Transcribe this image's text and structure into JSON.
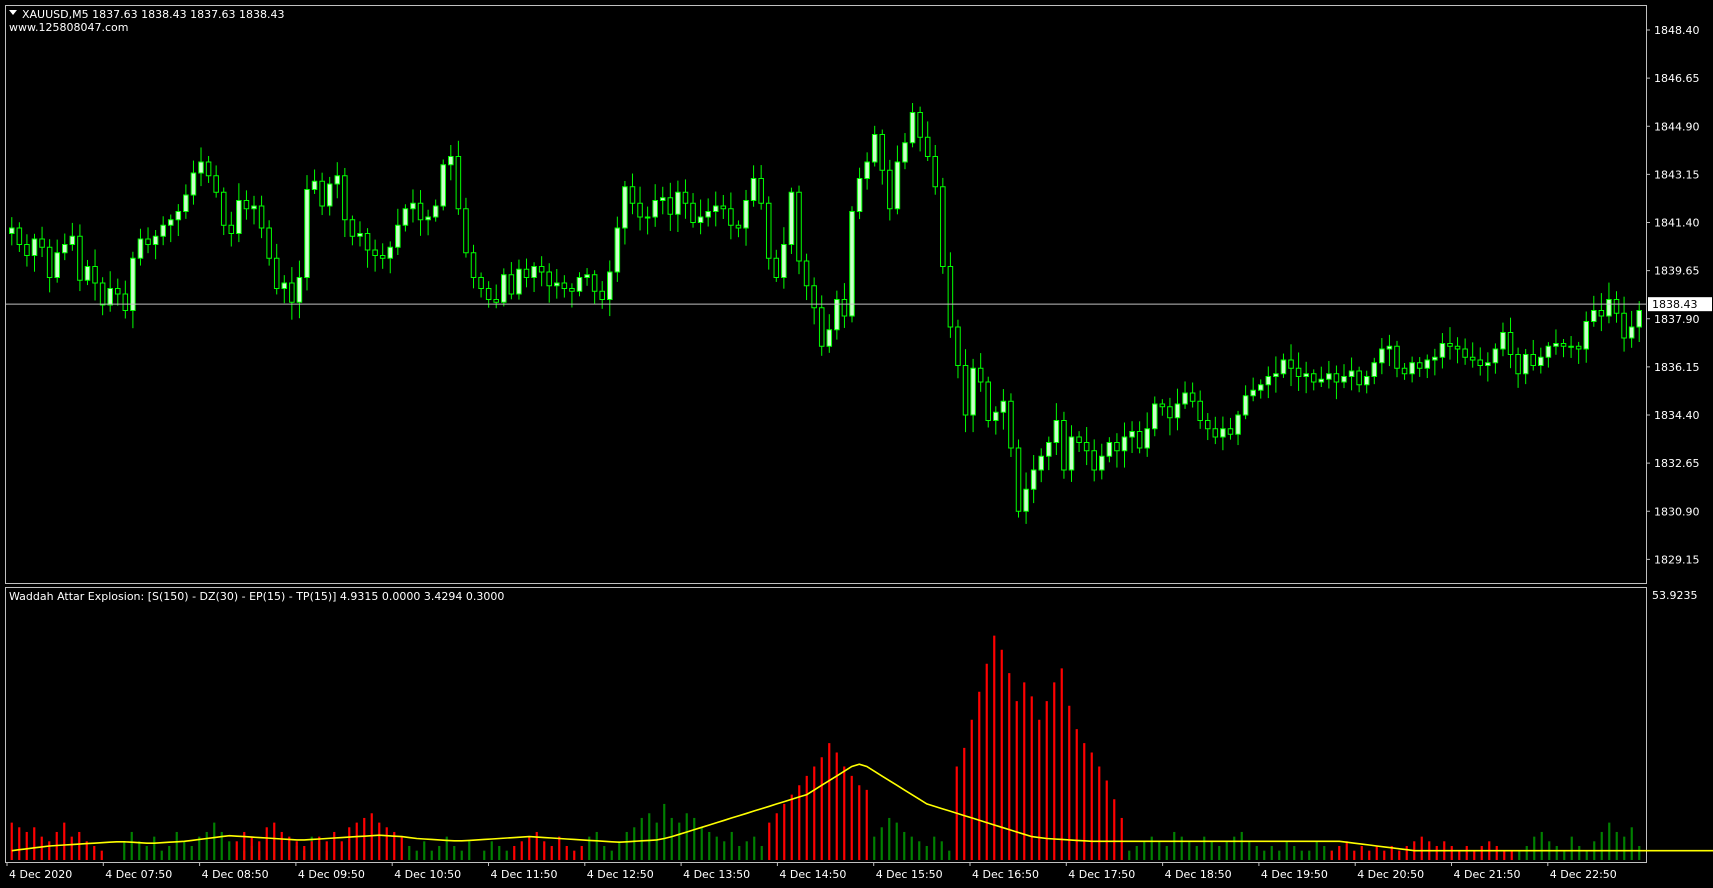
{
  "header": {
    "symbol_line": "XAUUSD,M5  1837.63 1838.43 1837.63 1838.43",
    "watermark": "www.125808047.com"
  },
  "indicator": {
    "label": "Waddah Attar Explosion: [S(150) - DZ(30) - EP(15) - TP(15)] 4.9315 0.0000 3.4294 0.3000",
    "max_label": "53.9235"
  },
  "price_axis": {
    "labels": [
      "1848.40",
      "1846.65",
      "1844.90",
      "1843.15",
      "1841.40",
      "1839.65",
      "1837.90",
      "1836.15",
      "1834.40",
      "1832.65",
      "1830.90",
      "1829.15"
    ],
    "current_price": "1838.43"
  },
  "time_axis": {
    "labels": [
      "4 Dec 2020",
      "4 Dec 07:50",
      "4 Dec 08:50",
      "4 Dec 09:50",
      "4 Dec 10:50",
      "4 Dec 11:50",
      "4 Dec 12:50",
      "4 Dec 13:50",
      "4 Dec 14:50",
      "4 Dec 15:50",
      "4 Dec 16:50",
      "4 Dec 17:50",
      "4 Dec 18:50",
      "4 Dec 19:50",
      "4 Dec 20:50",
      "4 Dec 21:50",
      "4 Dec 22:50"
    ]
  },
  "colors": {
    "background": "#000000",
    "candle_up": "#ccffcc",
    "candle_down": "#000000",
    "wick": "#00ff00",
    "grid_line": "#c0c0c0",
    "hist_up": "#008000",
    "hist_down": "#ff0000",
    "signal_line": "#ffff00"
  },
  "chart_data": [
    {
      "type": "candlestick",
      "title": "XAUUSD,M5",
      "y_range": [
        1828.4,
        1849.2
      ],
      "current": 1838.43,
      "closes": [
        1841.2,
        1840.6,
        1840.2,
        1840.8,
        1840.5,
        1839.4,
        1840.3,
        1840.6,
        1840.9,
        1839.3,
        1839.8,
        1839.2,
        1838.4,
        1839.0,
        1838.8,
        1838.2,
        1840.1,
        1840.8,
        1840.6,
        1840.9,
        1841.3,
        1841.5,
        1841.8,
        1842.4,
        1843.2,
        1843.6,
        1843.1,
        1842.5,
        1841.3,
        1841.0,
        1842.2,
        1841.9,
        1842.0,
        1841.2,
        1840.1,
        1839.0,
        1839.2,
        1838.5,
        1839.4,
        1842.6,
        1842.9,
        1842.0,
        1842.8,
        1843.1,
        1841.5,
        1840.9,
        1841.0,
        1840.4,
        1840.2,
        1840.1,
        1840.5,
        1841.3,
        1841.9,
        1842.1,
        1841.5,
        1841.6,
        1842.0,
        1843.5,
        1843.8,
        1841.9,
        1840.3,
        1839.4,
        1839.0,
        1838.6,
        1838.5,
        1839.5,
        1838.8,
        1839.7,
        1839.4,
        1839.8,
        1839.6,
        1839.1,
        1839.2,
        1839.0,
        1838.9,
        1839.4,
        1839.5,
        1838.9,
        1838.6,
        1839.6,
        1841.2,
        1842.7,
        1842.1,
        1841.6,
        1841.6,
        1842.2,
        1842.3,
        1841.7,
        1842.5,
        1842.1,
        1841.4,
        1841.6,
        1841.8,
        1842.0,
        1841.9,
        1841.3,
        1841.2,
        1842.2,
        1843.0,
        1842.1,
        1840.1,
        1839.4,
        1840.6,
        1842.5,
        1840.0,
        1839.1,
        1838.3,
        1836.9,
        1837.5,
        1838.6,
        1838.0,
        1841.8,
        1843.0,
        1843.6,
        1844.6,
        1843.3,
        1841.9,
        1843.6,
        1844.3,
        1845.4,
        1844.5,
        1843.8,
        1842.7,
        1839.8,
        1837.6,
        1836.2,
        1834.4,
        1836.1,
        1835.6,
        1834.2,
        1834.5,
        1834.9,
        1833.2,
        1830.9,
        1831.7,
        1832.4,
        1832.9,
        1833.4,
        1834.2,
        1832.4,
        1833.6,
        1833.4,
        1833.1,
        1832.4,
        1832.9,
        1833.4,
        1833.1,
        1833.6,
        1833.8,
        1833.2,
        1833.9,
        1834.8,
        1834.7,
        1834.3,
        1834.8,
        1835.2,
        1834.9,
        1834.2,
        1833.9,
        1833.6,
        1833.9,
        1833.7,
        1834.4,
        1835.1,
        1835.3,
        1835.5,
        1835.8,
        1835.9,
        1836.4,
        1836.1,
        1835.8,
        1835.9,
        1835.6,
        1835.7,
        1835.9,
        1835.6,
        1835.8,
        1836.0,
        1835.5,
        1835.8,
        1836.3,
        1836.8,
        1836.9,
        1836.1,
        1835.9,
        1836.3,
        1836.1,
        1836.4,
        1836.5,
        1837.0,
        1836.9,
        1836.8,
        1836.5,
        1836.4,
        1836.2,
        1836.3,
        1836.8,
        1837.4,
        1836.6,
        1835.9,
        1836.6,
        1836.2,
        1836.5,
        1836.9,
        1837.0,
        1836.9,
        1836.9,
        1836.8,
        1837.8,
        1838.2,
        1838.0,
        1838.6,
        1838.1,
        1837.2,
        1837.6,
        1838.2
      ]
    },
    {
      "type": "bar",
      "title": "Waddah Attar Explosion",
      "y_max": 53.9235,
      "series": [
        {
          "name": "up",
          "values": [
            0,
            0,
            0,
            0,
            0,
            0,
            0,
            0,
            0,
            0,
            0,
            0,
            0,
            0,
            0,
            4,
            6,
            4,
            3,
            5,
            2,
            3,
            6,
            4,
            3,
            5,
            6,
            8,
            6,
            4,
            0,
            2,
            3,
            2,
            0,
            5,
            0,
            4,
            3,
            2,
            5,
            4,
            2,
            0,
            0,
            0,
            0,
            0,
            0,
            0,
            0,
            0,
            0,
            3,
            2,
            4,
            2,
            3,
            5,
            3,
            2,
            4,
            0,
            2,
            4,
            3,
            2,
            0,
            0,
            0,
            0,
            0,
            0,
            0,
            0,
            0,
            0,
            5,
            6,
            3,
            2,
            4,
            6,
            7,
            9,
            10,
            8,
            12,
            9,
            8,
            10,
            9,
            7,
            6,
            5,
            4,
            6,
            3,
            4,
            5,
            3,
            0,
            0,
            0,
            0,
            0,
            0,
            0,
            0,
            0,
            0,
            0,
            0,
            0,
            0,
            5,
            7,
            9,
            8,
            6,
            5,
            4,
            3,
            5,
            4,
            2,
            0,
            0,
            0,
            0,
            0,
            0,
            0,
            0,
            0,
            0,
            0,
            0,
            0,
            0,
            0,
            0,
            0,
            0,
            0,
            0,
            0,
            0,
            0,
            2,
            3,
            4,
            5,
            4,
            3,
            6,
            5,
            4,
            3,
            5,
            4,
            3,
            4,
            5,
            6,
            4,
            3,
            2,
            3,
            2,
            4,
            3,
            2,
            2,
            4,
            3,
            2,
            0,
            0,
            0,
            0,
            0,
            0,
            0,
            0,
            0,
            0,
            0,
            0,
            0,
            0,
            0,
            0,
            0,
            0,
            0,
            0,
            0,
            0,
            0,
            0,
            2,
            3,
            5,
            6,
            4,
            3,
            2,
            5,
            3,
            2,
            4,
            6,
            8,
            6,
            5,
            7,
            3
          ]
        },
        {
          "name": "down",
          "values": [
            8,
            7,
            6,
            7,
            5,
            4,
            6,
            8,
            5,
            6,
            4,
            3,
            2,
            0,
            0,
            0,
            0,
            0,
            0,
            0,
            0,
            0,
            0,
            0,
            0,
            0,
            0,
            0,
            0,
            0,
            4,
            6,
            5,
            4,
            7,
            8,
            6,
            5,
            4,
            3,
            4,
            5,
            4,
            6,
            4,
            7,
            8,
            9,
            10,
            8,
            7,
            6,
            5,
            0,
            0,
            0,
            0,
            0,
            0,
            0,
            0,
            0,
            0,
            0,
            0,
            0,
            0,
            3,
            4,
            5,
            6,
            4,
            3,
            5,
            3,
            2,
            3,
            0,
            0,
            0,
            0,
            0,
            0,
            0,
            0,
            0,
            0,
            0,
            0,
            0,
            0,
            0,
            0,
            0,
            0,
            0,
            0,
            0,
            0,
            0,
            0,
            8,
            10,
            12,
            14,
            16,
            18,
            20,
            22,
            25,
            23,
            20,
            18,
            16,
            15,
            0,
            0,
            0,
            0,
            0,
            0,
            0,
            0,
            0,
            0,
            0,
            20,
            24,
            30,
            36,
            42,
            48,
            45,
            40,
            34,
            38,
            35,
            30,
            34,
            38,
            41,
            33,
            28,
            25,
            23,
            20,
            17,
            13,
            9,
            0,
            0,
            0,
            0,
            0,
            0,
            0,
            0,
            0,
            0,
            0,
            0,
            0,
            0,
            0,
            0,
            0,
            0,
            0,
            0,
            0,
            0,
            0,
            0,
            0,
            0,
            0,
            2,
            3,
            4,
            2,
            3,
            2,
            3,
            2,
            3,
            2,
            3,
            4,
            5,
            4,
            3,
            4,
            3,
            2,
            3,
            2,
            3,
            4,
            3,
            2,
            2,
            0,
            0,
            0,
            0,
            0,
            0,
            0,
            0,
            0,
            0,
            0,
            0,
            0,
            0,
            0,
            0,
            0,
            0
          ]
        },
        {
          "name": "signal",
          "values": [
            2,
            2.2,
            2.4,
            2.6,
            2.8,
            3,
            3.1,
            3.2,
            3.3,
            3.4,
            3.5,
            3.6,
            3.7,
            3.8,
            3.9,
            3.9,
            3.8,
            3.7,
            3.6,
            3.6,
            3.7,
            3.8,
            3.9,
            4,
            4.2,
            4.4,
            4.6,
            4.8,
            5,
            5.2,
            5.1,
            5,
            4.9,
            4.8,
            4.7,
            4.6,
            4.5,
            4.4,
            4.3,
            4.3,
            4.4,
            4.5,
            4.6,
            4.7,
            4.8,
            4.9,
            5,
            5.1,
            5.2,
            5.3,
            5.2,
            5.1,
            5,
            4.8,
            4.6,
            4.5,
            4.4,
            4.3,
            4.2,
            4.1,
            4.1,
            4.2,
            4.3,
            4.4,
            4.5,
            4.6,
            4.7,
            4.8,
            4.9,
            5,
            4.9,
            4.8,
            4.7,
            4.6,
            4.5,
            4.4,
            4.3,
            4.2,
            4.1,
            4,
            3.9,
            3.8,
            3.9,
            4,
            4.1,
            4.2,
            4.3,
            4.6,
            5,
            5.5,
            6,
            6.5,
            7,
            7.5,
            8,
            8.5,
            9,
            9.5,
            10,
            10.5,
            11,
            11.5,
            12,
            12.5,
            13,
            13.5,
            14,
            15,
            16,
            17,
            18,
            19,
            20,
            20.5,
            20,
            19,
            18,
            17,
            16,
            15,
            14,
            13,
            12,
            11.5,
            11,
            10.5,
            10,
            9.5,
            9,
            8.5,
            8,
            7.5,
            7,
            6.5,
            6,
            5.5,
            5,
            4.8,
            4.6,
            4.5,
            4.4,
            4.3,
            4.2,
            4.1,
            4,
            4,
            4,
            4,
            4,
            4,
            4,
            4,
            4,
            4,
            4,
            4,
            4,
            4,
            4,
            4,
            4,
            4,
            4,
            4,
            4,
            4,
            4,
            4,
            4,
            4,
            4,
            4,
            4,
            4,
            4,
            4,
            4,
            4,
            3.8,
            3.6,
            3.4,
            3.2,
            3,
            2.8,
            2.6,
            2.4,
            2.2,
            2,
            2,
            2,
            2,
            2,
            2,
            2,
            2,
            2,
            2,
            2,
            2,
            2,
            2,
            2,
            2,
            2,
            2,
            2,
            2,
            2,
            2,
            2,
            2,
            2,
            2,
            2,
            2,
            2,
            2,
            2,
            2,
            2,
            2,
            2,
            2,
            2,
            2,
            2,
            2,
            2,
            2,
            2,
            2,
            2
          ]
        }
      ]
    }
  ]
}
